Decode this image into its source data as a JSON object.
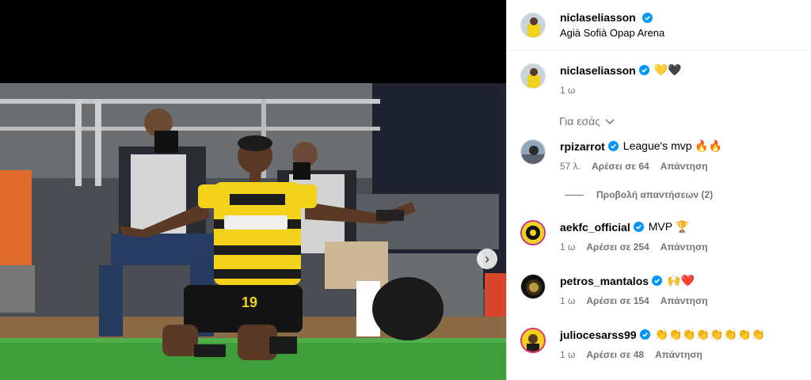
{
  "post": {
    "author": "niclaseliasson",
    "location": "Agià Sofià Opap Arena"
  },
  "caption": {
    "author": "niclaseliasson",
    "text": "💛🖤",
    "time": "1 ω"
  },
  "sort_label": "Για εσάς",
  "comments": [
    {
      "author": "rpizarrot",
      "text": "League's mvp 🔥🔥",
      "time": "57 λ.",
      "likes": "Αρέσει σε 64",
      "reply": "Απάντηση"
    },
    {
      "author": "aekfc_official",
      "text": "MVP 🏆",
      "time": "1 ω",
      "likes": "Αρέσει σε 254",
      "reply": "Απάντηση"
    },
    {
      "author": "petros_mantalos",
      "text": "🙌❤️",
      "time": "1 ω",
      "likes": "Αρέσει σε 154",
      "reply": "Απάντηση"
    },
    {
      "author": "juliocesarss99",
      "text": "👏👏👏👏👏👏👏👏",
      "time": "1 ω",
      "likes": "Αρέσει σε 48",
      "reply": "Απάντηση"
    }
  ],
  "view_replies": "Προβολή απαντήσεων (2)",
  "colors": {
    "verified": "#0095f6",
    "muted": "#737373",
    "kit_yellow": "#f2d21a"
  },
  "photo_jersey_number": "19"
}
